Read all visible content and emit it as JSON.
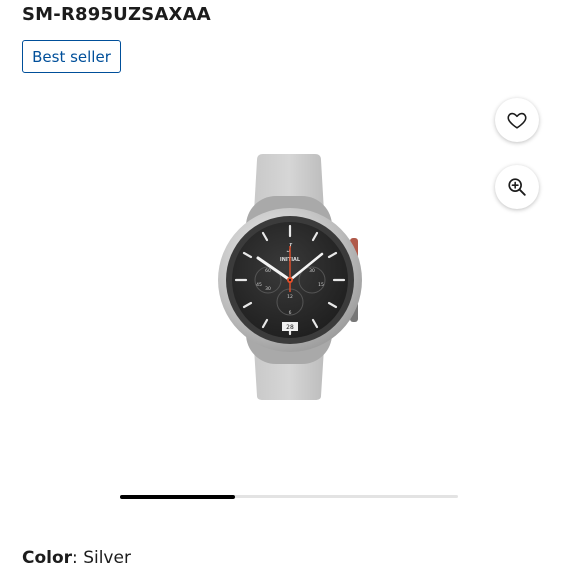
{
  "product": {
    "model_number": "SM-R895UZSAXAA",
    "badge": "Best seller",
    "color_label": "Color",
    "color_separator": ":",
    "color_value": "Silver"
  },
  "image_dial": {
    "brand_text": "INITIAL",
    "date_window": "28",
    "subdial_labels": [
      "60",
      "30",
      "45",
      "15",
      "30",
      "12",
      "6"
    ]
  },
  "carousel": {
    "progress": 0.34,
    "slides_indicator": "image-carousel"
  },
  "icons": {
    "favorite": "heart-icon",
    "zoom": "zoom-in-icon"
  },
  "colors": {
    "badge_border": "#004f9a",
    "accent_hand": "#e8502a",
    "track": "#e3e3e3"
  }
}
